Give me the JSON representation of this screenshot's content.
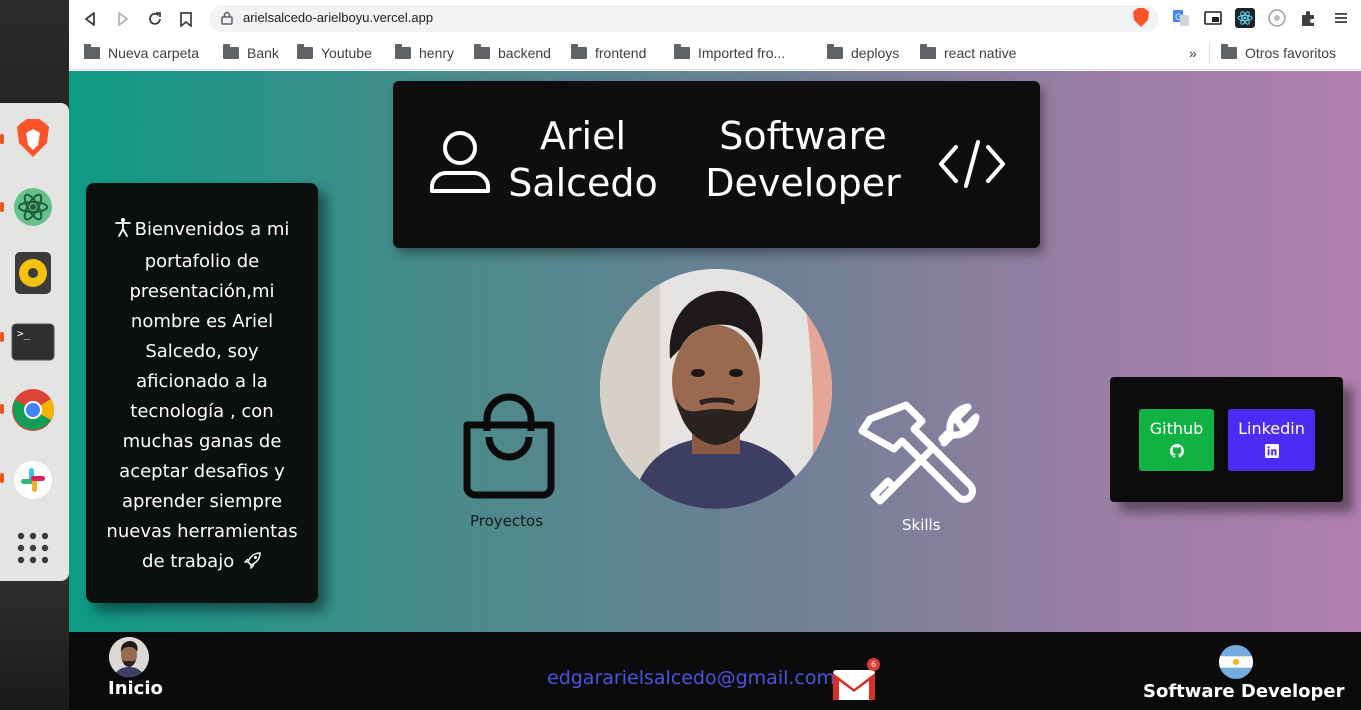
{
  "browser": {
    "url": "arielsalcedo-arielboyu.vercel.app",
    "bookmarks": [
      "Nueva carpeta",
      "Bank",
      "Youtube",
      "henry",
      "backend",
      "frontend",
      "Imported fro...",
      "deploys",
      "react native"
    ],
    "more_label": "»",
    "other_bookmarks": "Otros favoritos"
  },
  "header": {
    "name": "Ariel Salcedo",
    "name_line1": "Ariel",
    "name_line2": "Salcedo",
    "role_line1": "Software",
    "role_line2": "Developer"
  },
  "intro": {
    "text": "Bienvenidos a mi portafolio de presentación,mi nombre es Ariel Salcedo, soy aficionado a la tecnología , con muchas ganas de aceptar desafios y aprender siempre nuevas herramientas de trabajo"
  },
  "nav": {
    "projects_label": "Proyectos",
    "skills_label": "Skills"
  },
  "social": {
    "github_label": "Github",
    "linkedin_label": "Linkedin"
  },
  "footer": {
    "home_label": "Inicio",
    "email": "edgararielsalcedo@gmail.com",
    "mail_badge": "6",
    "role": "Software Developer"
  },
  "colors": {
    "github_btn": "#10b243",
    "linkedin_btn": "#4b2cf5",
    "email_link": "#4a55e0",
    "bg_left": "#0e9a86",
    "bg_right": "#b07fb0"
  }
}
